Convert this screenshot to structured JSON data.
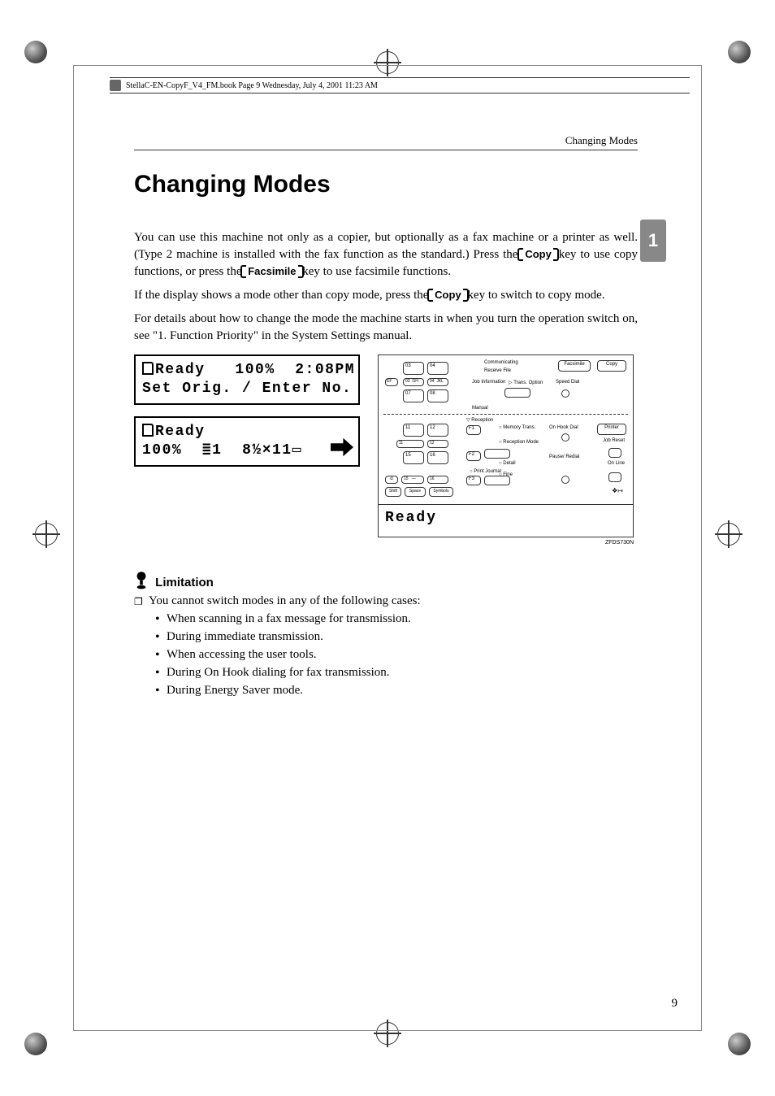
{
  "header_line": "StellaC-EN-CopyF_V4_FM.book  Page 9  Wednesday, July 4, 2001  11:23 AM",
  "running_header": "Changing Modes",
  "title": "Changing Modes",
  "side_tab": "1",
  "paragraphs": {
    "p1_a": "You can use this machine not only as a copier, but optionally as a fax machine or a printer as well. (Type 2 machine is installed with the fax function as the standard.) Press the ",
    "p1_key1": "Copy",
    "p1_b": " key to use copy functions, or press the ",
    "p1_key2": "Facsimile",
    "p1_c": " key to use facsimile functions.",
    "p2_a": "If the display shows a mode other than copy mode, press the ",
    "p2_key": "Copy",
    "p2_b": " key to switch to copy mode.",
    "p3": "For details about how to change the mode the machine starts in when you turn the operation switch on, see \"1. Function Priority\" in the System Settings manual."
  },
  "lcd1": {
    "line1_a": "Ready",
    "line1_b": "100%",
    "line1_c": "2:08PM",
    "line2": "Set Orig. / Enter No."
  },
  "lcd2": {
    "line1": "Ready",
    "line2_a": "100%",
    "line2_b": "1",
    "line2_c": "8½×11"
  },
  "panel": {
    "labels": {
      "communicating": "Communicating",
      "receive_file": "Receive File",
      "facsimile": "Facsimile",
      "copy": "Copy",
      "job_info": "Job Information",
      "trans_option": "Trans. Option",
      "speed_dial": "Speed Dial",
      "manual": "Manual",
      "reception": "Reception",
      "memory_trans": "Memory Trans.",
      "on_hook": "On Hook Dial",
      "printer": "Printer",
      "reception_mode": "Reception Mode",
      "job_reset": "Job Reset",
      "detail": "Detail",
      "pause_redial": "Pause/ Redial",
      "on_line": "On Line",
      "print_journal": "Print Journal",
      "fine": "Fine",
      "shift": "Shift",
      "space": "Space",
      "symbols": "Symbols"
    },
    "keys": {
      "k03": "03",
      "k04": "04",
      "k07": "07",
      "k08": "08",
      "k11": "11",
      "k12": "12",
      "k15": "15",
      "k16": "16",
      "kef": "EF",
      "kgh": "GH",
      "kij": "IJ",
      "kkl": "KL",
      "kf1": "F1",
      "kf2": "F2",
      "kf3": "F3"
    },
    "ready": "Ready",
    "code": "ZFDS730N"
  },
  "limitation": {
    "heading": "Limitation",
    "intro": "You cannot switch modes in any of the following cases:",
    "items": [
      "When scanning in a fax message for transmission.",
      "During immediate transmission.",
      "When accessing the user tools.",
      "During On Hook dialing for fax transmission.",
      "During Energy Saver mode."
    ]
  },
  "page_number": "9"
}
